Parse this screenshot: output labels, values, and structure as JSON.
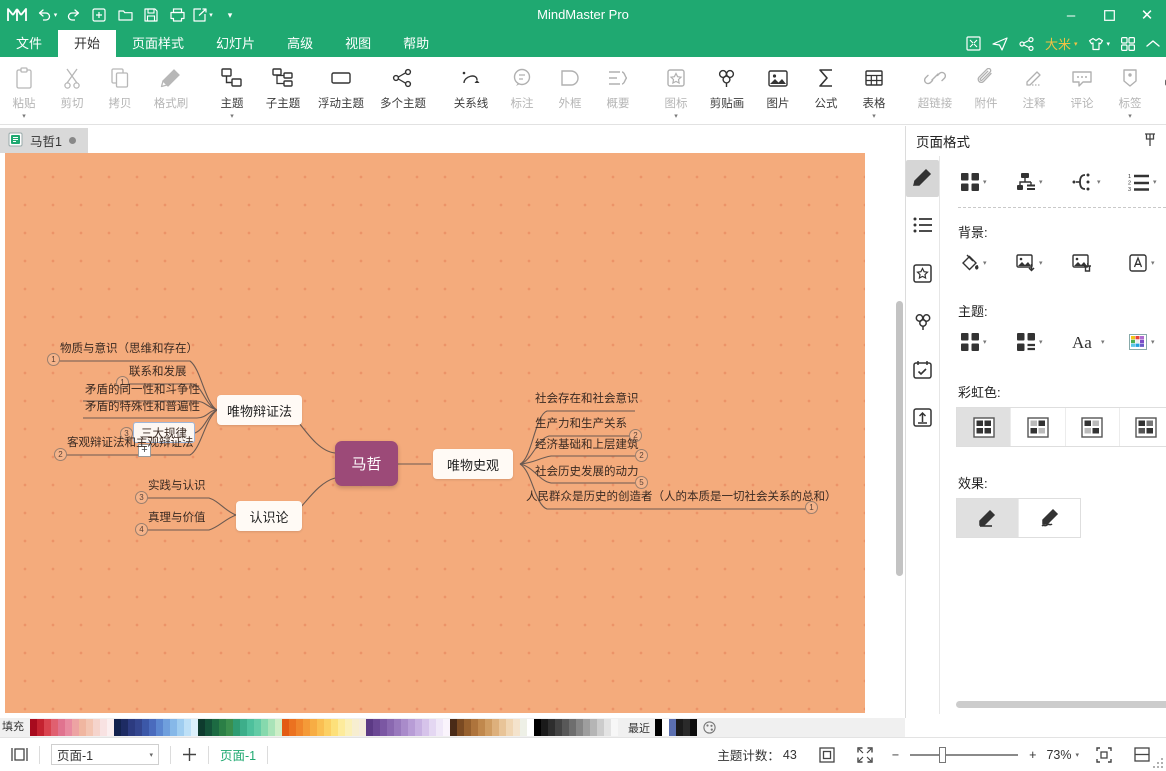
{
  "app": {
    "title": "MindMaster Pro",
    "quick_access": [
      "undo-icon",
      "redo-icon",
      "new-icon",
      "open-icon",
      "save-icon",
      "print-icon",
      "export-icon",
      "more-icon"
    ],
    "window_buttons": {
      "minimize": "–",
      "maximize": "❐",
      "close": "✕"
    }
  },
  "menubar": {
    "tabs": [
      {
        "label": "文件",
        "active": false
      },
      {
        "label": "开始",
        "active": true
      },
      {
        "label": "页面样式",
        "active": false
      },
      {
        "label": "幻灯片",
        "active": false
      },
      {
        "label": "高级",
        "active": false
      },
      {
        "label": "视图",
        "active": false
      },
      {
        "label": "帮助",
        "active": false
      }
    ],
    "user": "大米",
    "right_icons": [
      "fullscreen-icon",
      "send-icon",
      "share-icon",
      "theme-icon",
      "grid-icon",
      "collapse-icon"
    ]
  },
  "ribbon": {
    "groups": [
      {
        "buttons": [
          {
            "label": "粘贴",
            "icon": "paste-icon",
            "dim": true,
            "arrow": true
          },
          {
            "label": "剪切",
            "icon": "cut-icon",
            "dim": true,
            "arrow": false
          },
          {
            "label": "拷贝",
            "icon": "copy-icon",
            "dim": true,
            "arrow": false
          },
          {
            "label": "格式刷",
            "icon": "format-painter-icon",
            "dim": true,
            "arrow": false
          }
        ]
      },
      {
        "buttons": [
          {
            "label": "主题",
            "icon": "topic-icon",
            "dim": false,
            "arrow": true
          },
          {
            "label": "子主题",
            "icon": "subtopic-icon",
            "dim": false,
            "arrow": false
          },
          {
            "label": "浮动主题",
            "icon": "floating-topic-icon",
            "dim": false,
            "arrow": false
          },
          {
            "label": "多个主题",
            "icon": "multi-topic-icon",
            "dim": false,
            "arrow": false
          }
        ]
      },
      {
        "buttons": [
          {
            "label": "关系线",
            "icon": "relationship-icon",
            "dim": false,
            "arrow": false
          },
          {
            "label": "标注",
            "icon": "callout-icon",
            "dim": true,
            "arrow": false
          },
          {
            "label": "外框",
            "icon": "boundary-icon",
            "dim": true,
            "arrow": false
          },
          {
            "label": "概要",
            "icon": "summary-icon",
            "dim": true,
            "arrow": false
          }
        ]
      },
      {
        "buttons": [
          {
            "label": "图标",
            "icon": "marker-icon",
            "dim": true,
            "arrow": true
          },
          {
            "label": "剪贴画",
            "icon": "clipart-icon",
            "dim": false,
            "arrow": false
          },
          {
            "label": "图片",
            "icon": "picture-icon",
            "dim": false,
            "arrow": false
          },
          {
            "label": "公式",
            "icon": "formula-icon",
            "dim": false,
            "arrow": false
          },
          {
            "label": "表格",
            "icon": "table-icon",
            "dim": false,
            "arrow": true
          }
        ]
      },
      {
        "buttons": [
          {
            "label": "超链接",
            "icon": "hyperlink-icon",
            "dim": true,
            "arrow": false
          },
          {
            "label": "附件",
            "icon": "attachment-icon",
            "dim": true,
            "arrow": false
          },
          {
            "label": "注释",
            "icon": "note-icon",
            "dim": true,
            "arrow": false
          },
          {
            "label": "评论",
            "icon": "comment-icon",
            "dim": true,
            "arrow": false
          },
          {
            "label": "标签",
            "icon": "tag-icon",
            "dim": true,
            "arrow": true
          }
        ]
      }
    ],
    "last_button": {
      "icon": "outline-structure-icon",
      "arrow": true
    }
  },
  "document_tab": {
    "name": "马哲1",
    "modified": true,
    "icon": "document-icon"
  },
  "mindmap": {
    "root": {
      "text": "马哲",
      "color": "#9c4a78"
    },
    "branches": [
      {
        "text": "唯物辩证法",
        "children": [
          {
            "text": "物质与意识（思维和存在）",
            "badge": "1"
          },
          {
            "text": "联系和发展",
            "badge": "1"
          },
          {
            "text": "矛盾的同一性和斗争性",
            "badge": ""
          },
          {
            "text": "矛盾的特殊性和普遍性",
            "badge": ""
          },
          {
            "text": "三大规律",
            "badge": "3",
            "selected": true
          },
          {
            "text": "客观辩证法和主观辩证法",
            "badge": "2"
          }
        ]
      },
      {
        "text": "认识论",
        "children": [
          {
            "text": "实践与认识",
            "badge": "3"
          },
          {
            "text": "真理与价值",
            "badge": "4"
          }
        ]
      },
      {
        "text": "唯物史观",
        "children": [
          {
            "text": "社会存在和社会意识",
            "badge": ""
          },
          {
            "text": "生产力和生产关系",
            "badge": "2"
          },
          {
            "text": "经济基础和上层建筑",
            "badge": "2"
          },
          {
            "text": "社会历史发展的动力",
            "badge": "5"
          },
          {
            "text": "人民群众是历史的创造者（人的本质是一切社会关系的总和）",
            "badge": "1"
          }
        ]
      }
    ],
    "expand_button": "+"
  },
  "panel": {
    "title": "页面格式",
    "pin_icon": "pin-icon",
    "rail": [
      {
        "name": "page-format-icon",
        "active": true
      },
      {
        "name": "outline-list-icon",
        "active": false
      },
      {
        "name": "marker-star-icon",
        "active": false
      },
      {
        "name": "clipart-clover-icon",
        "active": false
      },
      {
        "name": "task-calendar-icon",
        "active": false
      },
      {
        "name": "export-box-icon",
        "active": false
      }
    ],
    "layout_row": [
      {
        "icon": "layout-grid-icon",
        "arrow": true
      },
      {
        "icon": "layout-org-icon",
        "arrow": true
      },
      {
        "icon": "layout-branch-icon",
        "arrow": true
      },
      {
        "icon": "layout-numbered-icon",
        "arrow": true
      }
    ],
    "background": {
      "label": "背景:",
      "items": [
        {
          "icon": "fill-bucket-icon",
          "arrow": true
        },
        {
          "icon": "image-add-icon",
          "arrow": true
        },
        {
          "icon": "image-delete-icon",
          "arrow": false
        },
        {
          "icon": "watermark-icon",
          "arrow": true
        }
      ]
    },
    "theme": {
      "label": "主题:",
      "items": [
        {
          "icon": "theme-grid-icon",
          "arrow": true
        },
        {
          "icon": "theme-style-icon",
          "arrow": true
        },
        {
          "icon": "font-icon",
          "arrow": true
        },
        {
          "icon": "color-palette-icon",
          "arrow": true
        }
      ]
    },
    "rainbow": {
      "label": "彩虹色:",
      "options": [
        {
          "name": "rainbow-option-1",
          "active": true
        },
        {
          "name": "rainbow-option-2",
          "active": false
        },
        {
          "name": "rainbow-option-3",
          "active": false
        },
        {
          "name": "rainbow-option-4",
          "active": false
        }
      ]
    },
    "effect": {
      "label": "效果:",
      "options": [
        {
          "name": "effect-straight-pen",
          "active": true
        },
        {
          "name": "effect-sketch-pen",
          "active": false
        }
      ]
    }
  },
  "palette": {
    "label": "填充",
    "recent_label": "最近",
    "recent_colors": [
      "#000000",
      "#ffffff",
      "#5b6fb0",
      "#1b1b1b",
      "#2a2a2a",
      "#0d0d0d"
    ],
    "more_icon": "color-wheel-icon",
    "colors": [
      "#a80b1e",
      "#c42230",
      "#d9434f",
      "#e06070",
      "#e0738f",
      "#e88aa0",
      "#eda3a3",
      "#f0b6a0",
      "#f3c5b2",
      "#f5d4cc",
      "#f8e2e2",
      "#fbeff0",
      "#12224e",
      "#1d2b63",
      "#2c3b80",
      "#34468f",
      "#3c58a8",
      "#4a6bbd",
      "#5b86d0",
      "#6f9fdd",
      "#86b8e8",
      "#9fcdf0",
      "#bde0f7",
      "#dcf0fb",
      "#0e3b2e",
      "#145239",
      "#1c6a42",
      "#2b7f46",
      "#3b8f4e",
      "#2f9c73",
      "#3dae8a",
      "#4ec09c",
      "#63cba6",
      "#86d9ad",
      "#a9e3b8",
      "#cdeec7",
      "#e35b13",
      "#eb7220",
      "#f0862c",
      "#f49a38",
      "#f7ad44",
      "#fabf52",
      "#fcd064",
      "#fde07a",
      "#fdeb9b",
      "#fbf0b8",
      "#f7eed0",
      "#f5ecdc",
      "#5c3a85",
      "#6b4894",
      "#7b57a3",
      "#8a68b0",
      "#9979bd",
      "#a98bca",
      "#b89dd6",
      "#c7b0e1",
      "#d6c3ea",
      "#e4d7f2",
      "#f0e8f8",
      "#faf4fc",
      "#4a2b17",
      "#7a4a22",
      "#96602e",
      "#ae743c",
      "#c0884d",
      "#cf9c62",
      "#ddb07c",
      "#e8c498",
      "#f0d6b4",
      "#f4e3cc",
      "#eef0e6",
      "#ffffff",
      "#000000",
      "#1a1a1a",
      "#2e2e2e",
      "#434343",
      "#585858",
      "#6e6e6e",
      "#868686",
      "#9e9e9e",
      "#b5b5b5",
      "#cccccc",
      "#e3e3e3",
      "#f7f7f7"
    ]
  },
  "statusbar": {
    "view_icon": "page-view-icon",
    "page_select": "页面-1",
    "add_page": "+",
    "page_link": "页面-1",
    "topic_count_label": "主题计数：",
    "topic_count": "43",
    "fit_icon": "fit-page-icon",
    "fullscreen_icon": "fullscreen-icon",
    "zoom_out": "−",
    "zoom_in": "+",
    "zoom_level": "73%",
    "center_icon": "center-icon",
    "split_icon": "split-icon"
  }
}
